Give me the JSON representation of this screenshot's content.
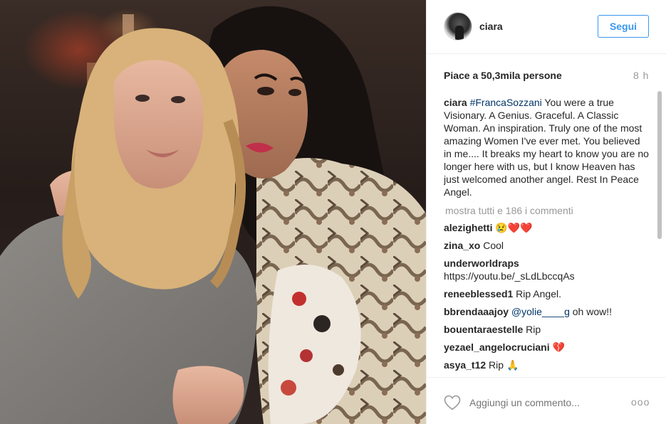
{
  "post": {
    "image_alt": "Two women posing together at a dinner"
  },
  "header": {
    "username": "ciara",
    "follow_label": "Segui"
  },
  "stats": {
    "likes": "Piace a 50,3mila persone",
    "age": "8 h"
  },
  "caption": {
    "username": "ciara",
    "hashtag": "#FrancaSozzani",
    "text": " You were a true Visionary. A Genius. Graceful. A Classic Woman. An inspiration. Truly one of the most amazing Women I've ever met. You believed in me.... It breaks my heart to know you are no longer here with us, but I know Heaven has just welcomed another angel. Rest In Peace Angel."
  },
  "show_all_comments": "mostra tutti e 186 i commenti",
  "comments": [
    {
      "user": "alezighetti",
      "text": " 😢❤️❤️"
    },
    {
      "user": "zina_xo",
      "text": " Cool"
    },
    {
      "user": "underworldraps",
      "text": " https://youtu.be/_sLdLbccqAs"
    },
    {
      "user": "reneeblessed1",
      "text": " Rip Angel."
    },
    {
      "user": "bbrendaaajoy",
      "mention": "@yolie____g",
      "text": " oh wow!!"
    },
    {
      "user": "bouentaraestelle",
      "text": " Rip"
    },
    {
      "user": "yezael_angelocruciani",
      "text": " 💔"
    },
    {
      "user": "asya_t12",
      "text": " Rip 🙏"
    }
  ],
  "footer": {
    "add_comment_placeholder": "Aggiungi un commento...",
    "more_options": "ooo"
  },
  "icons": {
    "like": "heart-outline-icon",
    "options": "ellipsis-icon"
  },
  "colors": {
    "accent": "#3897f0",
    "hashtag": "#003569",
    "muted": "#999999",
    "text": "#262626"
  }
}
